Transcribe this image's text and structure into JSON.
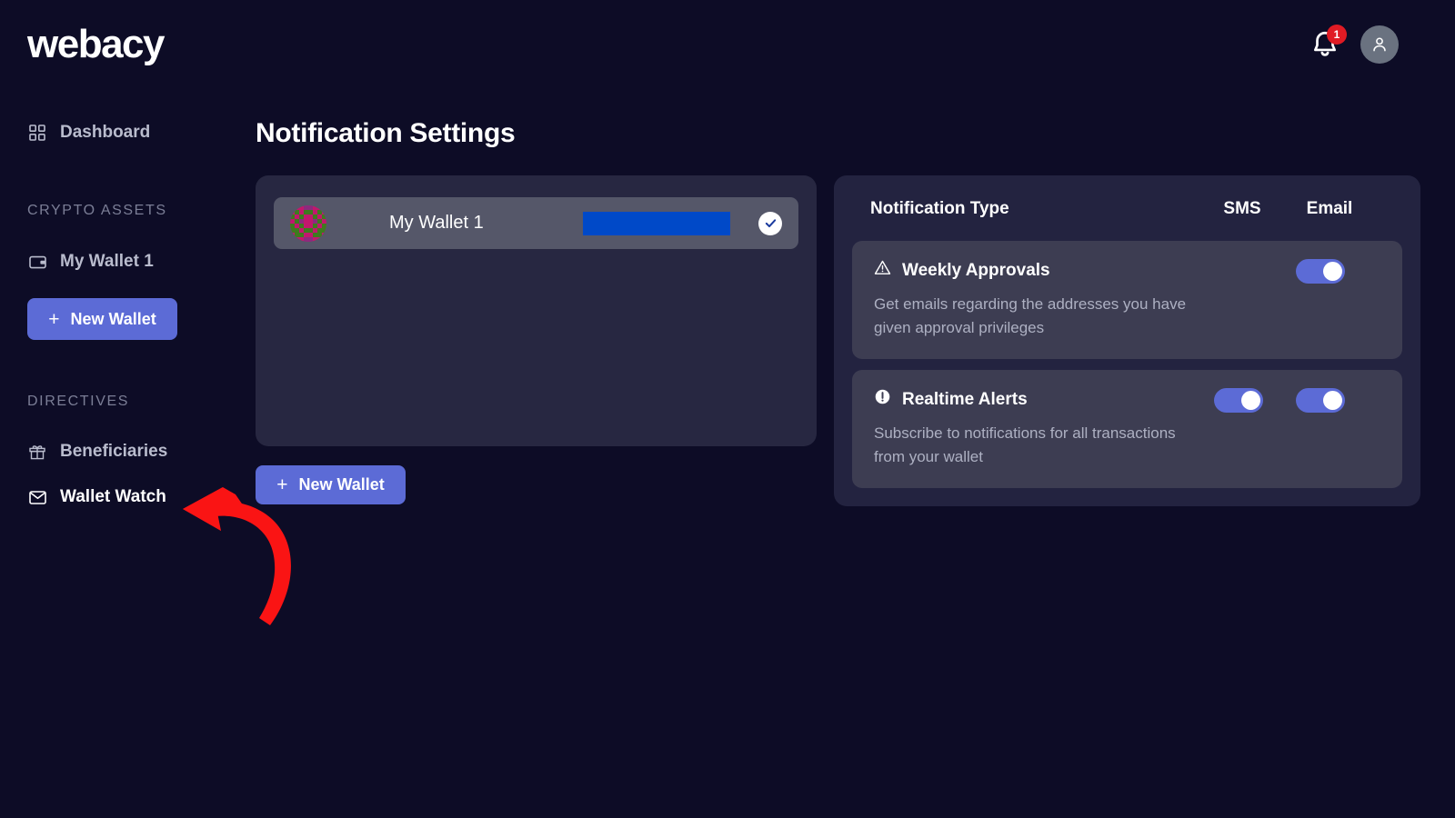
{
  "brand": {
    "logo_text": "webacy"
  },
  "header": {
    "notification_badge_count": "1",
    "bell_icon": "bell-icon",
    "avatar_icon": "user-avatar-icon"
  },
  "sidebar": {
    "items": [
      {
        "label": "Dashboard",
        "icon": "grid-icon",
        "active": false
      },
      {
        "label": "My Wallet 1",
        "icon": "wallet-icon",
        "active": false
      },
      {
        "label": "Beneficiaries",
        "icon": "gift-icon",
        "active": false
      },
      {
        "label": "Wallet Watch",
        "icon": "envelope-icon",
        "active": true
      }
    ],
    "sections": {
      "crypto_assets": "CRYPTO ASSETS",
      "directives": "DIRECTIVES"
    },
    "new_wallet_button": "New Wallet",
    "plus": "+"
  },
  "main": {
    "page_title": "Notification Settings",
    "new_wallet_button": "New Wallet",
    "plus": "+",
    "wallets": [
      {
        "name": "My Wallet 1",
        "address_redacted": true,
        "selected": true,
        "avatar_icon": "identicon-avatar"
      }
    ]
  },
  "notifications": {
    "columns": {
      "type": "Notification Type",
      "sms": "SMS",
      "email": "Email"
    },
    "rows": [
      {
        "title": "Weekly Approvals",
        "icon": "warning-triangle-icon",
        "description": "Get emails regarding the addresses you have given approval privileges",
        "sms_enabled": false,
        "sms_visible": false,
        "email_enabled": true
      },
      {
        "title": "Realtime Alerts",
        "icon": "exclamation-circle-icon",
        "description": "Subscribe to notifications for all transactions from your wallet",
        "sms_enabled": true,
        "sms_visible": true,
        "email_enabled": true
      }
    ]
  },
  "annotation": {
    "arrow_color": "#fa1414",
    "points_to": "Wallet Watch"
  },
  "colors": {
    "background": "#0d0c26",
    "panel": "#272741",
    "panel_alt": "#232340",
    "row": "#3d3d52",
    "wallet_row": "#555769",
    "accent": "#5c6bd6",
    "redaction": "#0049c8",
    "badge": "#e01b24",
    "muted_text": "#b9bccd"
  }
}
